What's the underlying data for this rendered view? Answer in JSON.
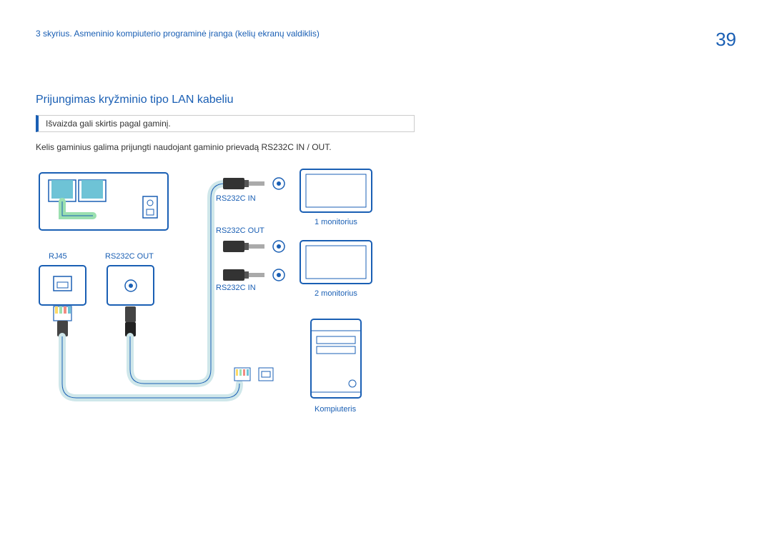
{
  "header": {
    "chapter": "3 skyrius. Asmeninio kompiuterio programinė įranga (kelių ekranų valdiklis)",
    "page_number": "39"
  },
  "section": {
    "title": "Prijungimas kryžminio tipo LAN kabeliu",
    "note": "Išvaizda gali skirtis pagal gaminį.",
    "body": "Kelis gaminius galima prijungti naudojant gaminio prievadą RS232C IN / OUT."
  },
  "diagram_labels": {
    "rj45": "RJ45",
    "rs232c_out": "RS232C OUT",
    "rs232c_in_top": "RS232C IN",
    "rs232c_out_mid": "RS232C OUT",
    "rs232c_in_bot": "RS232C IN",
    "monitor1": "1 monitorius",
    "monitor2": "2 monitorius",
    "computer": "Kompiuteris"
  }
}
